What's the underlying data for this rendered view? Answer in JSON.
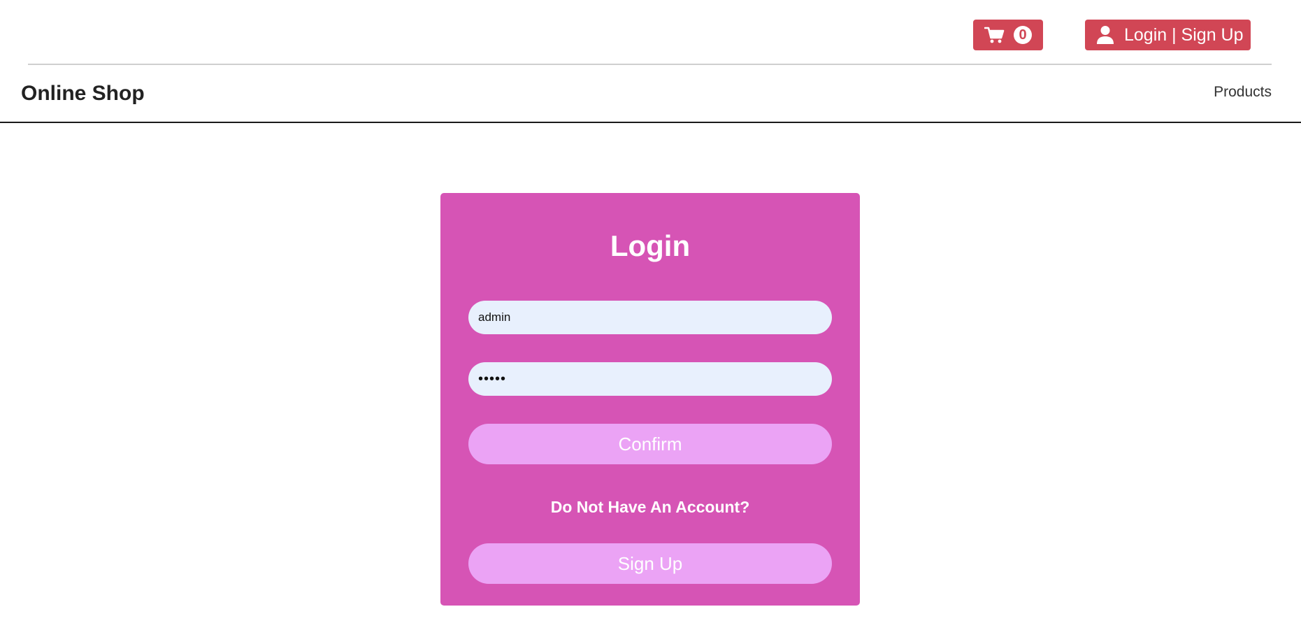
{
  "header": {
    "cart": {
      "icon": "shopping-cart-icon",
      "count": "0"
    },
    "account": {
      "icon": "user-icon",
      "label": "Login | Sign Up"
    },
    "button_color": "#d14655"
  },
  "navbar": {
    "brand": "Online Shop",
    "links": [
      {
        "label": "Products"
      }
    ]
  },
  "login_form": {
    "title": "Login",
    "username_value": "admin",
    "password_value": "•••••",
    "confirm_label": "Confirm",
    "no_account_text": "Do Not Have An Account?",
    "signup_label": "Sign Up",
    "card_color": "#d654b5",
    "button_color": "#eba3f5",
    "field_color": "#e8f0fd"
  }
}
